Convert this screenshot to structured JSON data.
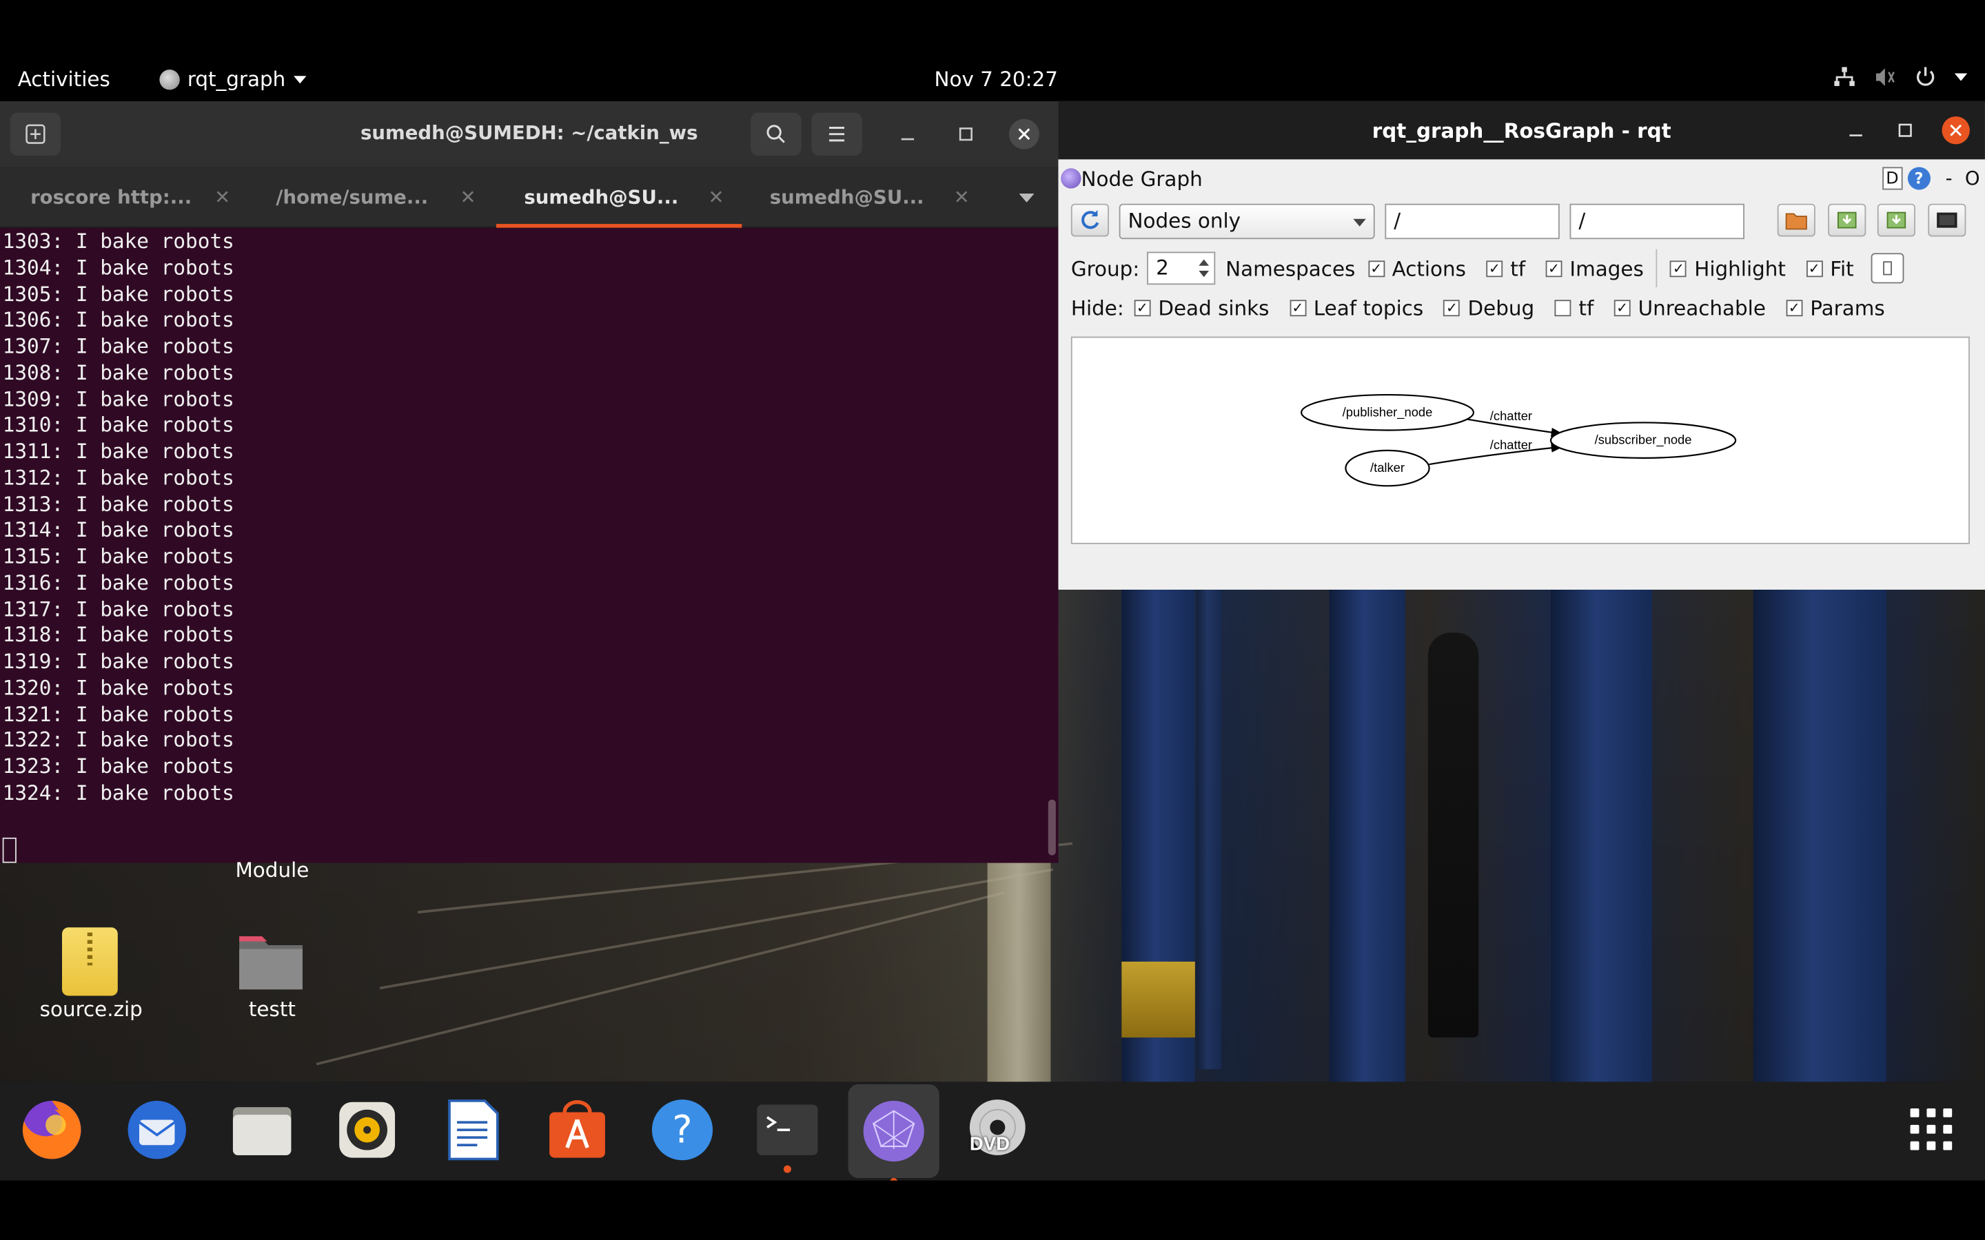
{
  "topbar": {
    "activities": "Activities",
    "app_name": "rqt_graph",
    "clock": "Nov 7  20:27"
  },
  "terminal": {
    "title": "sumedh@SUMEDH: ~/catkin_ws",
    "tabs": [
      {
        "label": "roscore http:..."
      },
      {
        "label": "/home/sume..."
      },
      {
        "label": "sumedh@SU..."
      },
      {
        "label": "sumedh@SU..."
      }
    ],
    "lines": [
      "1303: I bake robots",
      "1304: I bake robots",
      "1305: I bake robots",
      "1306: I bake robots",
      "1307: I bake robots",
      "1308: I bake robots",
      "1309: I bake robots",
      "1310: I bake robots",
      "1311: I bake robots",
      "1312: I bake robots",
      "1313: I bake robots",
      "1314: I bake robots",
      "1315: I bake robots",
      "1316: I bake robots",
      "1317: I bake robots",
      "1318: I bake robots",
      "1319: I bake robots",
      "1320: I bake robots",
      "1321: I bake robots",
      "1322: I bake robots",
      "1323: I bake robots",
      "1324: I bake robots"
    ]
  },
  "rqt": {
    "title": "rqt_graph__RosGraph - rqt",
    "plugin_title": "Node Graph",
    "plugin_d": "D",
    "plugin_help": "?",
    "plugin_dash": "-",
    "plugin_o": "O",
    "view_mode": "Nodes only",
    "ns_filter": "/",
    "topic_filter": "/",
    "group_label": "Group:",
    "group_value": "2",
    "namespaces_label": "Namespaces",
    "actions_label": "Actions",
    "tf_label": "tf",
    "images_label": "Images",
    "highlight_label": "Highlight",
    "fit_label": "Fit",
    "hide_label": "Hide:",
    "dead_sinks_label": "Dead sinks",
    "leaf_topics_label": "Leaf topics",
    "debug_label": "Debug",
    "hide_tf_label": "tf",
    "unreachable_label": "Unreachable",
    "params_label": "Params",
    "checked_mark": "✓",
    "graph": {
      "nodes": [
        "/publisher_node",
        "/talker",
        "/subscriber_node"
      ],
      "edges": [
        {
          "from": "/publisher_node",
          "to": "/subscriber_node",
          "label": "/chatter"
        },
        {
          "from": "/talker",
          "to": "/subscriber_node",
          "label": "/chatter"
        }
      ]
    }
  },
  "desktop": {
    "module_label": "Module",
    "icons": [
      {
        "label": "source.zip"
      },
      {
        "label": "testt"
      }
    ]
  },
  "dock": {
    "items": [
      "Firefox",
      "Thunderbird",
      "Files",
      "Rhythmbox",
      "LibreOffice Writer",
      "Ubuntu Software",
      "Help",
      "Terminal",
      "rqt",
      "DVD"
    ],
    "dvd_label": "DVD"
  },
  "colors": {
    "terminal_bg": "#300a24",
    "accent": "#e95420",
    "rqt_bg": "#efefef"
  }
}
